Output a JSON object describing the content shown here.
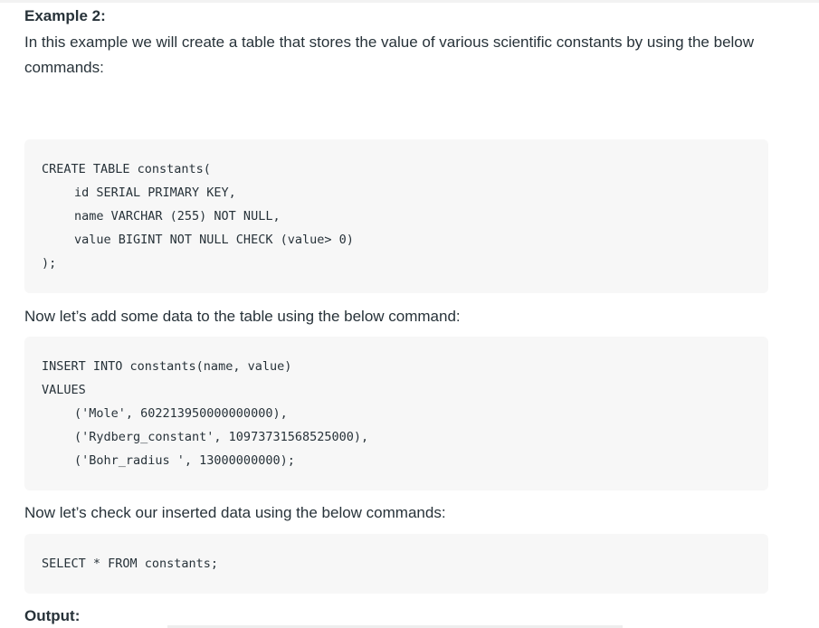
{
  "example_heading": "Example 2:",
  "intro_text": "In this example we will create a table that stores the value of various scientific constants by using the below commands:",
  "create_code": [
    "CREATE TABLE constants(",
    "id SERIAL PRIMARY KEY,",
    "name VARCHAR (255) NOT NULL,",
    "value BIGINT NOT NULL CHECK (value> 0)",
    ");"
  ],
  "insert_text": "Now let’s add some data to the table using the below command:",
  "insert_code": [
    "INSERT INTO constants(name, value)",
    "VALUES",
    "('Mole', 602213950000000000),",
    "('Rydberg_constant', 10973731568525000),",
    "('Bohr_radius ', 13000000000);"
  ],
  "check_text": "Now let’s check our inserted data using the below commands:",
  "select_code": [
    "SELECT * FROM constants;"
  ],
  "output_heading": "Output:"
}
